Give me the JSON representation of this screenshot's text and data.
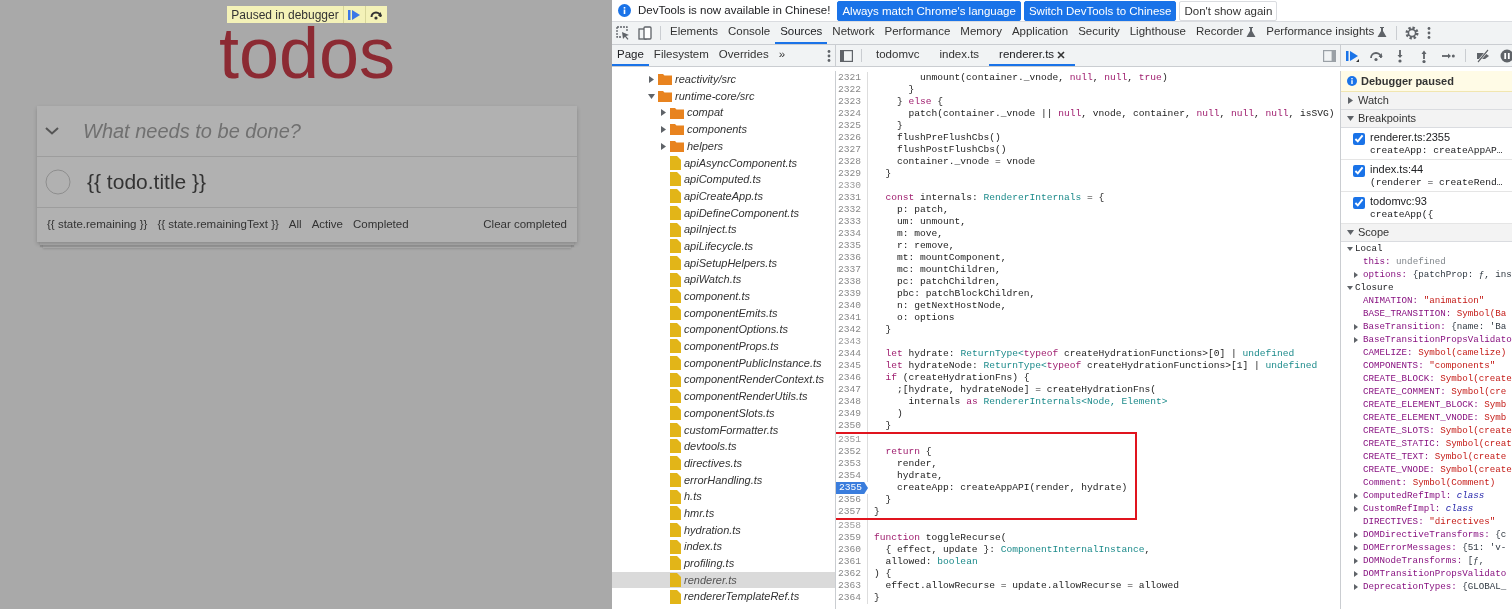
{
  "page": {
    "paused_banner": {
      "message": "Paused in debugger"
    },
    "title": "todos",
    "new_todo": {
      "placeholder": "What needs to be done?"
    },
    "todos": [
      {
        "title": "{{ todo.title }}",
        "completed": false
      }
    ],
    "footer": {
      "count": "{{ state.remaining }}",
      "count_label": "{{ state.remainingText }}",
      "filters": [
        "All",
        "Active",
        "Completed"
      ],
      "clear": "Clear completed"
    }
  },
  "infobar": {
    "message": "DevTools is now available in Chinese!",
    "buttons": [
      {
        "label": "Always match Chrome's language",
        "kind": "primary"
      },
      {
        "label": "Switch DevTools to Chinese",
        "kind": "primary"
      },
      {
        "label": "Don't show again",
        "kind": "secondary"
      }
    ]
  },
  "panel_tabs": [
    {
      "label": "Elements",
      "selected": false,
      "experimental": false
    },
    {
      "label": "Console",
      "selected": false,
      "experimental": false
    },
    {
      "label": "Sources",
      "selected": true,
      "experimental": false
    },
    {
      "label": "Network",
      "selected": false,
      "experimental": false
    },
    {
      "label": "Performance",
      "selected": false,
      "experimental": false
    },
    {
      "label": "Memory",
      "selected": false,
      "experimental": false
    },
    {
      "label": "Application",
      "selected": false,
      "experimental": false
    },
    {
      "label": "Security",
      "selected": false,
      "experimental": false
    },
    {
      "label": "Lighthouse",
      "selected": false,
      "experimental": false
    },
    {
      "label": "Recorder",
      "selected": false,
      "experimental": true
    },
    {
      "label": "Performance insights",
      "selected": false,
      "experimental": true
    }
  ],
  "navigator_tabs": [
    {
      "label": "Page",
      "selected": true
    },
    {
      "label": "Filesystem",
      "selected": false
    },
    {
      "label": "Overrides",
      "selected": false
    }
  ],
  "navigator_more": "»",
  "editor_tabs": [
    {
      "label": "todomvc",
      "selected": false,
      "closable": false
    },
    {
      "label": "index.ts",
      "selected": false,
      "closable": false
    },
    {
      "label": "renderer.ts",
      "selected": true,
      "closable": true
    }
  ],
  "file_tree": [
    {
      "name": "reactivity/src",
      "kind": "folder",
      "expanded": false,
      "selected": false
    },
    {
      "name": "runtime-core/src",
      "kind": "folder",
      "expanded": true,
      "selected": false,
      "children": [
        {
          "name": "compat",
          "kind": "folder",
          "expanded": false,
          "selected": false
        },
        {
          "name": "components",
          "kind": "folder",
          "expanded": false,
          "selected": false
        },
        {
          "name": "helpers",
          "kind": "folder",
          "expanded": false,
          "selected": false
        },
        {
          "name": "apiAsyncComponent.ts",
          "kind": "file",
          "selected": false
        },
        {
          "name": "apiComputed.ts",
          "kind": "file",
          "selected": false
        },
        {
          "name": "apiCreateApp.ts",
          "kind": "file",
          "selected": false
        },
        {
          "name": "apiDefineComponent.ts",
          "kind": "file",
          "selected": false
        },
        {
          "name": "apiInject.ts",
          "kind": "file",
          "selected": false
        },
        {
          "name": "apiLifecycle.ts",
          "kind": "file",
          "selected": false
        },
        {
          "name": "apiSetupHelpers.ts",
          "kind": "file",
          "selected": false
        },
        {
          "name": "apiWatch.ts",
          "kind": "file",
          "selected": false
        },
        {
          "name": "component.ts",
          "kind": "file",
          "selected": false
        },
        {
          "name": "componentEmits.ts",
          "kind": "file",
          "selected": false
        },
        {
          "name": "componentOptions.ts",
          "kind": "file",
          "selected": false
        },
        {
          "name": "componentProps.ts",
          "kind": "file",
          "selected": false
        },
        {
          "name": "componentPublicInstance.ts",
          "kind": "file",
          "selected": false
        },
        {
          "name": "componentRenderContext.ts",
          "kind": "file",
          "selected": false
        },
        {
          "name": "componentRenderUtils.ts",
          "kind": "file",
          "selected": false
        },
        {
          "name": "componentSlots.ts",
          "kind": "file",
          "selected": false
        },
        {
          "name": "customFormatter.ts",
          "kind": "file",
          "selected": false
        },
        {
          "name": "devtools.ts",
          "kind": "file",
          "selected": false
        },
        {
          "name": "directives.ts",
          "kind": "file",
          "selected": false
        },
        {
          "name": "errorHandling.ts",
          "kind": "file",
          "selected": false
        },
        {
          "name": "h.ts",
          "kind": "file",
          "selected": false
        },
        {
          "name": "hmr.ts",
          "kind": "file",
          "selected": false
        },
        {
          "name": "hydration.ts",
          "kind": "file",
          "selected": false
        },
        {
          "name": "index.ts",
          "kind": "file",
          "selected": false
        },
        {
          "name": "profiling.ts",
          "kind": "file",
          "selected": false
        },
        {
          "name": "renderer.ts",
          "kind": "file",
          "selected": true
        },
        {
          "name": "rendererTemplateRef.ts",
          "kind": "file",
          "selected": false
        }
      ]
    }
  ],
  "code": {
    "blocks": [
      {
        "highlighted": false,
        "lines": [
          {
            "number": "2321",
            "breakpoint": false,
            "tokens": [
              {
                "text": "        unmount(container._vnode, ",
                "kind": "plain"
              },
              {
                "text": "null",
                "kind": "keyword"
              },
              {
                "text": ", ",
                "kind": "plain"
              },
              {
                "text": "null",
                "kind": "keyword"
              },
              {
                "text": ", ",
                "kind": "plain"
              },
              {
                "text": "true",
                "kind": "keyword"
              },
              {
                "text": ")",
                "kind": "plain"
              }
            ]
          },
          {
            "number": "2322",
            "breakpoint": false,
            "tokens": [
              {
                "text": "      }",
                "kind": "plain"
              }
            ]
          },
          {
            "number": "2323",
            "breakpoint": false,
            "tokens": [
              {
                "text": "    } ",
                "kind": "plain"
              },
              {
                "text": "else",
                "kind": "keyword"
              },
              {
                "text": " {",
                "kind": "plain"
              }
            ]
          },
          {
            "number": "2324",
            "breakpoint": false,
            "tokens": [
              {
                "text": "      patch(container._vnode || ",
                "kind": "plain"
              },
              {
                "text": "null",
                "kind": "keyword"
              },
              {
                "text": ", vnode, container, ",
                "kind": "plain"
              },
              {
                "text": "null",
                "kind": "keyword"
              },
              {
                "text": ", ",
                "kind": "plain"
              },
              {
                "text": "null",
                "kind": "keyword"
              },
              {
                "text": ", ",
                "kind": "plain"
              },
              {
                "text": "null",
                "kind": "keyword"
              },
              {
                "text": ", isSVG)",
                "kind": "plain"
              }
            ]
          },
          {
            "number": "2325",
            "breakpoint": false,
            "tokens": [
              {
                "text": "    }",
                "kind": "plain"
              }
            ]
          },
          {
            "number": "2326",
            "breakpoint": false,
            "tokens": [
              {
                "text": "    flushPreFlushCbs()",
                "kind": "plain"
              }
            ]
          },
          {
            "number": "2327",
            "breakpoint": false,
            "tokens": [
              {
                "text": "    flushPostFlushCbs()",
                "kind": "plain"
              }
            ]
          },
          {
            "number": "2328",
            "breakpoint": false,
            "tokens": [
              {
                "text": "    container._vnode = vnode",
                "kind": "plain"
              }
            ]
          },
          {
            "number": "2329",
            "breakpoint": false,
            "tokens": [
              {
                "text": "  }",
                "kind": "plain"
              }
            ]
          },
          {
            "number": "2330",
            "breakpoint": false
          },
          {
            "number": "2331",
            "breakpoint": false,
            "tokens": [
              {
                "text": "  const",
                "kind": "keyword"
              },
              {
                "text": " internals: ",
                "kind": "plain"
              },
              {
                "text": "RendererInternals",
                "kind": "type"
              },
              {
                "text": " = {",
                "kind": "plain"
              }
            ]
          },
          {
            "number": "2332",
            "breakpoint": false,
            "tokens": [
              {
                "text": "    p: patch,",
                "kind": "plain"
              }
            ]
          },
          {
            "number": "2333",
            "breakpoint": false,
            "tokens": [
              {
                "text": "    um: unmount,",
                "kind": "plain"
              }
            ]
          },
          {
            "number": "2334",
            "breakpoint": false,
            "tokens": [
              {
                "text": "    m: move,",
                "kind": "plain"
              }
            ]
          },
          {
            "number": "2335",
            "breakpoint": false,
            "tokens": [
              {
                "text": "    r: remove,",
                "kind": "plain"
              }
            ]
          },
          {
            "number": "2336",
            "breakpoint": false,
            "tokens": [
              {
                "text": "    mt: mountComponent,",
                "kind": "plain"
              }
            ]
          },
          {
            "number": "2337",
            "breakpoint": false,
            "tokens": [
              {
                "text": "    mc: mountChildren,",
                "kind": "plain"
              }
            ]
          },
          {
            "number": "2338",
            "breakpoint": false,
            "tokens": [
              {
                "text": "    pc: patchChildren,",
                "kind": "plain"
              }
            ]
          },
          {
            "number": "2339",
            "breakpoint": false,
            "tokens": [
              {
                "text": "    pbc: patchBlockChildren,",
                "kind": "plain"
              }
            ]
          },
          {
            "number": "2340",
            "breakpoint": false,
            "tokens": [
              {
                "text": "    n: getNextHostNode,",
                "kind": "plain"
              }
            ]
          },
          {
            "number": "2341",
            "breakpoint": false,
            "tokens": [
              {
                "text": "    o: options",
                "kind": "plain"
              }
            ]
          },
          {
            "number": "2342",
            "breakpoint": false,
            "tokens": [
              {
                "text": "  }",
                "kind": "plain"
              }
            ]
          },
          {
            "number": "2343",
            "breakpoint": false
          },
          {
            "number": "2344",
            "breakpoint": false,
            "tokens": [
              {
                "text": "  let",
                "kind": "keyword"
              },
              {
                "text": " hydrate: ",
                "kind": "plain"
              },
              {
                "text": "ReturnType<",
                "kind": "type"
              },
              {
                "text": "typeof",
                "kind": "keyword"
              },
              {
                "text": " createHydrationFunctions>[0] | ",
                "kind": "plain"
              },
              {
                "text": "undefined",
                "kind": "type"
              }
            ]
          },
          {
            "number": "2345",
            "breakpoint": false,
            "tokens": [
              {
                "text": "  let",
                "kind": "keyword"
              },
              {
                "text": " hydrateNode: ",
                "kind": "plain"
              },
              {
                "text": "ReturnType<",
                "kind": "type"
              },
              {
                "text": "typeof",
                "kind": "keyword"
              },
              {
                "text": " createHydrationFunctions>[1] | ",
                "kind": "plain"
              },
              {
                "text": "undefined",
                "kind": "type"
              }
            ]
          },
          {
            "number": "2346",
            "breakpoint": false,
            "tokens": [
              {
                "text": "  if",
                "kind": "keyword"
              },
              {
                "text": " (createHydrationFns) {",
                "kind": "plain"
              }
            ]
          },
          {
            "number": "2347",
            "breakpoint": false,
            "tokens": [
              {
                "text": "    ;[hydrate, hydrateNode] = createHydrationFns(",
                "kind": "plain"
              }
            ]
          },
          {
            "number": "2348",
            "breakpoint": false,
            "tokens": [
              {
                "text": "      internals ",
                "kind": "plain"
              },
              {
                "text": "as",
                "kind": "keyword"
              },
              {
                "text": " RendererInternals<Node, Element>",
                "kind": "type"
              }
            ]
          },
          {
            "number": "2349",
            "breakpoint": false,
            "tokens": [
              {
                "text": "    )",
                "kind": "plain"
              }
            ]
          },
          {
            "number": "2350",
            "breakpoint": false,
            "tokens": [
              {
                "text": "  }",
                "kind": "plain"
              }
            ]
          }
        ]
      },
      {
        "highlighted": true,
        "lines": [
          {
            "number": "2351",
            "breakpoint": false
          },
          {
            "number": "2352",
            "breakpoint": false,
            "tokens": [
              {
                "text": "  return",
                "kind": "keyword"
              },
              {
                "text": " {",
                "kind": "plain"
              }
            ]
          },
          {
            "number": "2353",
            "breakpoint": false,
            "tokens": [
              {
                "text": "    render,",
                "kind": "plain"
              }
            ]
          },
          {
            "number": "2354",
            "breakpoint": false,
            "tokens": [
              {
                "text": "    hydrate,",
                "kind": "plain"
              }
            ]
          },
          {
            "number": "2355",
            "breakpoint": true,
            "tokens": [
              {
                "text": "    createApp: createAppAPI(render, hydrate)",
                "kind": "plain"
              }
            ]
          },
          {
            "number": "2356",
            "breakpoint": false,
            "tokens": [
              {
                "text": "  }",
                "kind": "plain"
              }
            ]
          },
          {
            "number": "2357",
            "breakpoint": false,
            "tokens": [
              {
                "text": "}",
                "kind": "plain"
              }
            ]
          }
        ]
      },
      {
        "highlighted": false,
        "lines": [
          {
            "number": "2358",
            "breakpoint": false
          },
          {
            "number": "2359",
            "breakpoint": false,
            "tokens": [
              {
                "text": "function",
                "kind": "keyword"
              },
              {
                "text": " toggleRecurse(",
                "kind": "plain"
              }
            ]
          },
          {
            "number": "2360",
            "breakpoint": false,
            "tokens": [
              {
                "text": "  { effect, update }: ",
                "kind": "plain"
              },
              {
                "text": "ComponentInternalInstance",
                "kind": "type"
              },
              {
                "text": ",",
                "kind": "plain"
              }
            ]
          },
          {
            "number": "2361",
            "breakpoint": false,
            "tokens": [
              {
                "text": "  allowed: ",
                "kind": "plain"
              },
              {
                "text": "boolean",
                "kind": "type"
              }
            ]
          },
          {
            "number": "2362",
            "breakpoint": false,
            "tokens": [
              {
                "text": ") {",
                "kind": "plain"
              }
            ]
          },
          {
            "number": "2363",
            "breakpoint": false,
            "tokens": [
              {
                "text": "  effect.allowRecurse = update.allowRecurse = allowed",
                "kind": "plain"
              }
            ]
          },
          {
            "number": "2364",
            "breakpoint": false,
            "tokens": [
              {
                "text": "}",
                "kind": "plain"
              }
            ]
          }
        ]
      }
    ]
  },
  "debugger": {
    "paused_message": "Debugger paused",
    "sections": [
      {
        "title": "Watch",
        "expanded": false
      },
      {
        "title": "Breakpoints",
        "expanded": true,
        "breakpoints": [
          {
            "location": "renderer.ts:2355",
            "code": "createApp: createAppAP…",
            "checked": true
          },
          {
            "location": "index.ts:44",
            "code": "(renderer = createRend…",
            "checked": true
          },
          {
            "location": "todomvc:93",
            "code": "createApp({",
            "checked": true
          }
        ]
      },
      {
        "title": "Scope",
        "expanded": true,
        "scopes": [
          {
            "name": "Local",
            "expanded": true,
            "entries": [
              {
                "key": "this:",
                "value": "undefined",
                "kind": "undefined",
                "expandable": false
              },
              {
                "key": "options:",
                "value": "{patchProp: ƒ, ins",
                "kind": "object",
                "expandable": true
              }
            ]
          },
          {
            "name": "Closure",
            "expanded": true,
            "entries": [
              {
                "key": "ANIMATION:",
                "value": "\"animation\"",
                "kind": "string",
                "expandable": false
              },
              {
                "key": "BASE_TRANSITION:",
                "value": "Symbol(Ba",
                "kind": "symbol",
                "expandable": false
              },
              {
                "key": "BaseTransition:",
                "value": "{name: 'Ba",
                "kind": "object",
                "expandable": true
              },
              {
                "key": "BaseTransitionPropsValidato",
                "expandable": true
              },
              {
                "key": "CAMELIZE:",
                "value": "Symbol(camelize)",
                "kind": "symbol",
                "expandable": false
              },
              {
                "key": "COMPONENTS:",
                "value": "\"components\"",
                "kind": "string",
                "expandable": false
              },
              {
                "key": "CREATE_BLOCK:",
                "value": "Symbol(create",
                "kind": "symbol",
                "expandable": false
              },
              {
                "key": "CREATE_COMMENT:",
                "value": "Symbol(cre",
                "kind": "symbol",
                "expandable": false
              },
              {
                "key": "CREATE_ELEMENT_BLOCK:",
                "value": "Symb",
                "kind": "symbol",
                "expandable": false
              },
              {
                "key": "CREATE_ELEMENT_VNODE:",
                "value": "Symb",
                "kind": "symbol",
                "expandable": false
              },
              {
                "key": "CREATE_SLOTS:",
                "value": "Symbol(create",
                "kind": "symbol",
                "expandable": false
              },
              {
                "key": "CREATE_STATIC:",
                "value": "Symbol(creat",
                "kind": "symbol",
                "expandable": false
              },
              {
                "key": "CREATE_TEXT:",
                "value": "Symbol(create",
                "kind": "symbol",
                "expandable": false
              },
              {
                "key": "CREATE_VNODE:",
                "value": "Symbol(create",
                "kind": "symbol",
                "expandable": false
              },
              {
                "key": "Comment:",
                "value": "Symbol(Comment)",
                "kind": "symbol",
                "expandable": false
              },
              {
                "key": "ComputedRefImpl:",
                "value": "class",
                "kind": "class",
                "expandable": true
              },
              {
                "key": "CustomRefImpl:",
                "value": "class",
                "kind": "class",
                "expandable": true
              },
              {
                "key": "DIRECTIVES:",
                "value": "\"directives\"",
                "kind": "string",
                "expandable": false
              },
              {
                "key": "DOMDirectiveTransforms:",
                "value": "{c",
                "kind": "object",
                "expandable": true
              },
              {
                "key": "DOMErrorMessages:",
                "value": "{51: 'v-",
                "kind": "object",
                "expandable": true
              },
              {
                "key": "DOMNodeTransforms:",
                "value": "[ƒ,",
                "kind": "object",
                "expandable": true
              },
              {
                "key": "DOMTransitionPropsValidato",
                "expandable": true
              },
              {
                "key": "DeprecationTypes:",
                "value": "{GLOBAL_",
                "kind": "object",
                "expandable": true
              }
            ]
          }
        ]
      }
    ]
  }
}
